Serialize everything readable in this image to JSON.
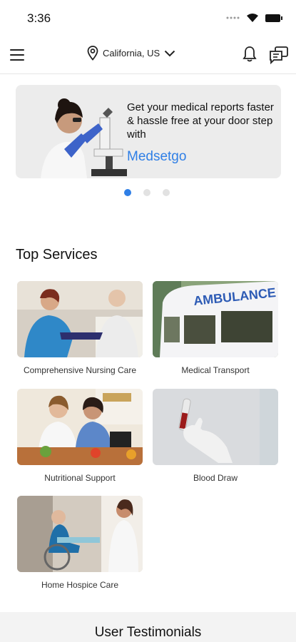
{
  "status": {
    "time": "3:36"
  },
  "header": {
    "location": "California, US"
  },
  "banner": {
    "text": "Get your medical reports faster & hassle free at your door step with",
    "brand": "Medsetgo"
  },
  "carousel": {
    "dots": 3,
    "active": 0
  },
  "services": {
    "title": "Top Services",
    "items": [
      {
        "label": "Comprehensive Nursing Care"
      },
      {
        "label": "Medical Transport"
      },
      {
        "label": "Nutritional Support"
      },
      {
        "label": "Blood Draw"
      },
      {
        "label": "Home Hospice Care"
      }
    ]
  },
  "testimonials": {
    "title": "User Testimonials"
  },
  "colors": {
    "accent": "#2f7fe6"
  }
}
